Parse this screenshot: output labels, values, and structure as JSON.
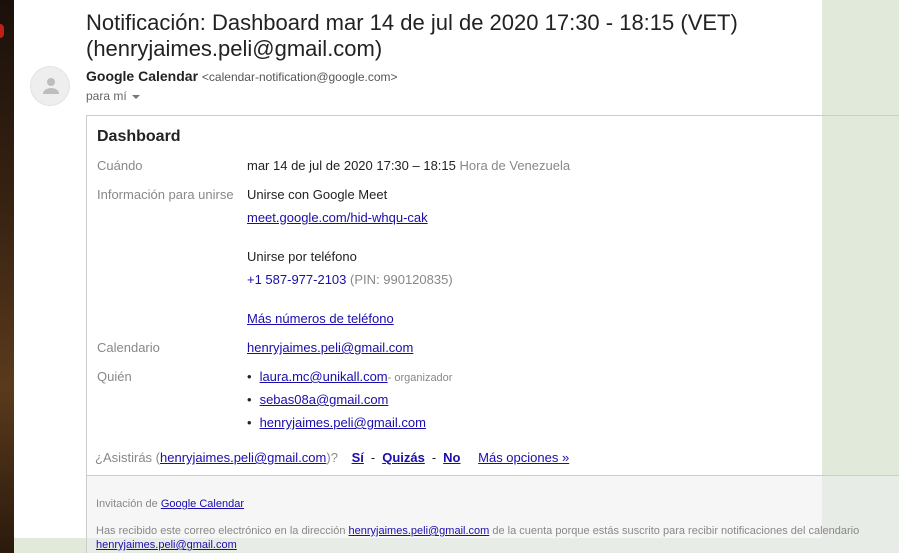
{
  "email": {
    "subject": "Notificación: Dashboard mar 14 de jul de 2020 17:30 - 18:15 (VET) (henryjaimes.peli@gmail.com)",
    "sender_name": "Google Calendar",
    "sender_address": "<calendar-notification@google.com>",
    "recipient": "para mí"
  },
  "event": {
    "title": "Dashboard",
    "when_label": "Cuándo",
    "when_value": "mar 14 de jul de 2020 17:30 – 18:15",
    "timezone": "Hora de Venezuela",
    "join_label": "Información para unirse",
    "meet_label": "Unirse con Google Meet",
    "meet_link": "meet.google.com/hid-whqu-cak",
    "phone_label": "Unirse por teléfono",
    "phone_number": "+1 587-977-2103",
    "pin": "(PIN: 990120835)",
    "more_numbers": "Más números de teléfono",
    "calendar_label": "Calendario",
    "calendar_value": "henryjaimes.peli@gmail.com",
    "who_label": "Quién",
    "guests": [
      {
        "email": "laura.mc@unikall.com",
        "role": "- organizador"
      },
      {
        "email": "sebas08a@gmail.com"
      },
      {
        "email": "henryjaimes.peli@gmail.com"
      }
    ]
  },
  "rsvp": {
    "prefix": "¿Asistirás (",
    "email": "henryjaimes.peli@gmail.com",
    "suffix": ")?",
    "yes": "Sí",
    "maybe": "Quizás",
    "no": "No",
    "more": "Más opciones »",
    "sep": "-"
  },
  "footer": {
    "invite_prefix": "Invitación de ",
    "invite_link": "Google Calendar",
    "notice_prefix": "Has recibido este correo electrónico en la dirección ",
    "notice_email": "henryjaimes.peli@gmail.com",
    "notice_middle": " de la cuenta porque estás suscrito para recibir notificaciones del calendario ",
    "notice_email2": "henryjaimes.peli@gmail.com"
  }
}
